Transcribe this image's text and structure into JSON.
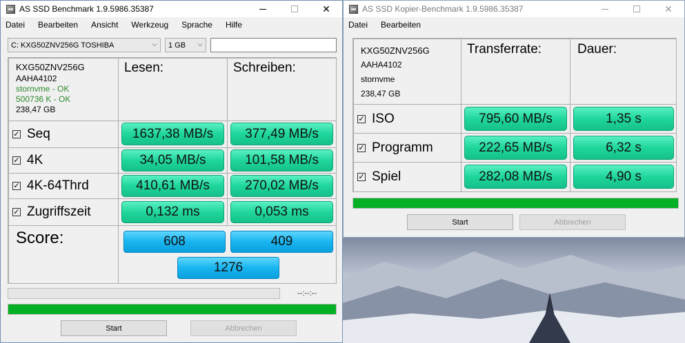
{
  "win1": {
    "title": "AS SSD Benchmark 1.9.5986.35387",
    "menu": [
      "Datei",
      "Bearbeiten",
      "Ansicht",
      "Werkzeug",
      "Sprache",
      "Hilfe"
    ],
    "drive_select": "C: KXG50ZNV256G TOSHIBA",
    "size_select": "1 GB",
    "info": {
      "model": "KXG50ZNV256G",
      "firmware": "AAHA4102",
      "driver": "stornvme - OK",
      "alignment": "500736 K - OK",
      "capacity": "238,47 GB"
    },
    "col_read": "Lesen:",
    "col_write": "Schreiben:",
    "rows": [
      {
        "label": "Seq",
        "read": "1637,38 MB/s",
        "write": "377,49 MB/s"
      },
      {
        "label": "4K",
        "read": "34,05 MB/s",
        "write": "101,58 MB/s"
      },
      {
        "label": "4K-64Thrd",
        "read": "410,61 MB/s",
        "write": "270,02 MB/s"
      },
      {
        "label": "Zugriffszeit",
        "read": "0,132 ms",
        "write": "0,053 ms"
      }
    ],
    "score_label": "Score:",
    "score_read": "608",
    "score_write": "409",
    "score_total": "1276",
    "timer": "--:--:--",
    "progress_fraction": 1.0,
    "start_label": "Start",
    "abort_label": "Abbrechen"
  },
  "win2": {
    "title": "AS SSD Kopier-Benchmark 1.9.5986.35387",
    "menu": [
      "Datei",
      "Bearbeiten"
    ],
    "info": {
      "model": "KXG50ZNV256G",
      "firmware": "AAHA4102",
      "driver": "stornvme",
      "capacity": "238,47 GB"
    },
    "col_rate": "Transferrate:",
    "col_time": "Dauer:",
    "rows": [
      {
        "label": "ISO",
        "rate": "795,60 MB/s",
        "time": "1,35 s"
      },
      {
        "label": "Programm",
        "rate": "222,65 MB/s",
        "time": "6,32 s"
      },
      {
        "label": "Spiel",
        "rate": "282,08 MB/s",
        "time": "4,90 s"
      }
    ],
    "progress_fraction": 1.0,
    "start_label": "Start",
    "abort_label": "Abbrechen"
  },
  "colors": {
    "result_green": "#1fd69c",
    "score_blue": "#18b5f0",
    "progress_green": "#06b025",
    "info_ok_green": "#2c8a2c"
  },
  "icons": [
    "app-icon",
    "minimize-icon",
    "maximize-icon",
    "close-icon",
    "chevron-down-icon",
    "checkbox-checked-icon"
  ]
}
